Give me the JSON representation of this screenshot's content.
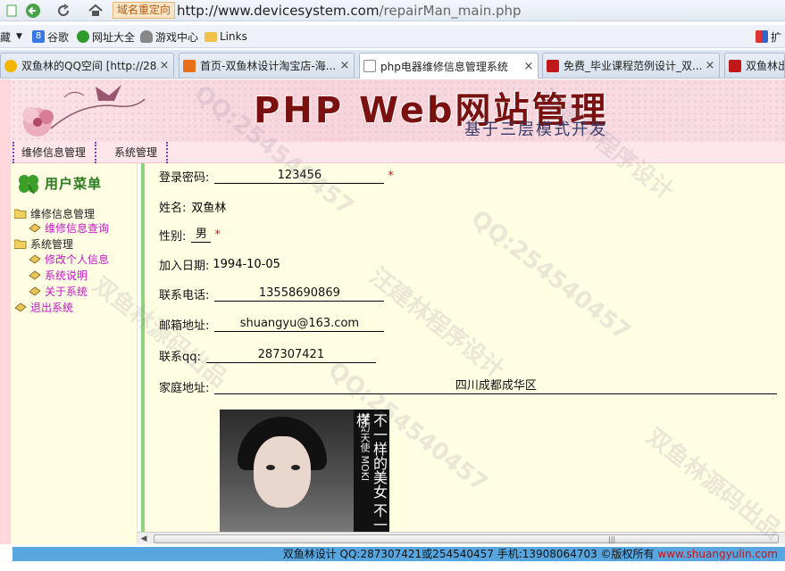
{
  "browser": {
    "redirect_label": "域名重定向",
    "url_host": "http://www.devicesystem.com",
    "url_path": "/repairMan_main.php",
    "bookmarks": {
      "menu_label": "藏",
      "items": [
        {
          "label": "谷歌"
        },
        {
          "label": "网址大全"
        },
        {
          "label": "游戏中心"
        },
        {
          "label": "Links"
        }
      ],
      "right_label": "扩"
    },
    "tabs": [
      {
        "title": "双鱼林的QQ空间 [http://28...",
        "active": false
      },
      {
        "title": "首页-双鱼林设计淘宝店-海...",
        "active": false
      },
      {
        "title": "php电器维修信息管理系统",
        "active": true
      },
      {
        "title": "免费_毕业课程范例设计_双...",
        "active": false
      },
      {
        "title": "双鱼林出",
        "active": false
      }
    ],
    "tab_close": "×"
  },
  "banner": {
    "title": "PHP Web网站管理",
    "subtitle": "基于三层模式开发"
  },
  "topnav": {
    "items": [
      "维修信息管理",
      "系统管理"
    ]
  },
  "sidebar": {
    "heading": "用户菜单",
    "tree": [
      {
        "label": "维修信息管理"
      },
      {
        "label": "维修信息查询"
      },
      {
        "label": "系统管理"
      },
      {
        "label": "修改个人信息"
      },
      {
        "label": "系统说明"
      },
      {
        "label": "关于系统"
      },
      {
        "label": "退出系统"
      }
    ]
  },
  "form": {
    "password": {
      "label": "登录密码:",
      "value": "123456",
      "required": "*"
    },
    "name": {
      "label": "姓名:",
      "value": "双鱼林"
    },
    "gender": {
      "label": "性别:",
      "value": "男",
      "required": "*"
    },
    "join_date": {
      "label": "加入日期:",
      "value": "1994-10-05"
    },
    "phone": {
      "label": "联系电话:",
      "value": "13558690869"
    },
    "email": {
      "label": "邮箱地址:",
      "value": "shuangyu@163.com"
    },
    "qq": {
      "label": "联系qq:",
      "value": "287307421"
    },
    "address": {
      "label": "家庭地址:",
      "value": "四川成都成华区"
    }
  },
  "photo": {
    "caption": "不一样的美女 不一样",
    "caption_small": "梦幻天使 MOKI"
  },
  "scrollbar": {
    "grip": "|||"
  },
  "footer": {
    "text": "双鱼林设计 QQ:287307421或254540457 手机:13908064703 ©版权所有 ",
    "site": "www.shuangyulin.com"
  },
  "watermark": {
    "texts": [
      "QQ:254540457",
      "汪建林程序设计",
      "双鱼林源码出品"
    ]
  },
  "colors": {
    "link": "#c61ac6",
    "content_bg": "#fffde2",
    "banner_title": "#7a1010",
    "footer_bg": "#58a6e0",
    "footer_site": "#c4141e"
  }
}
